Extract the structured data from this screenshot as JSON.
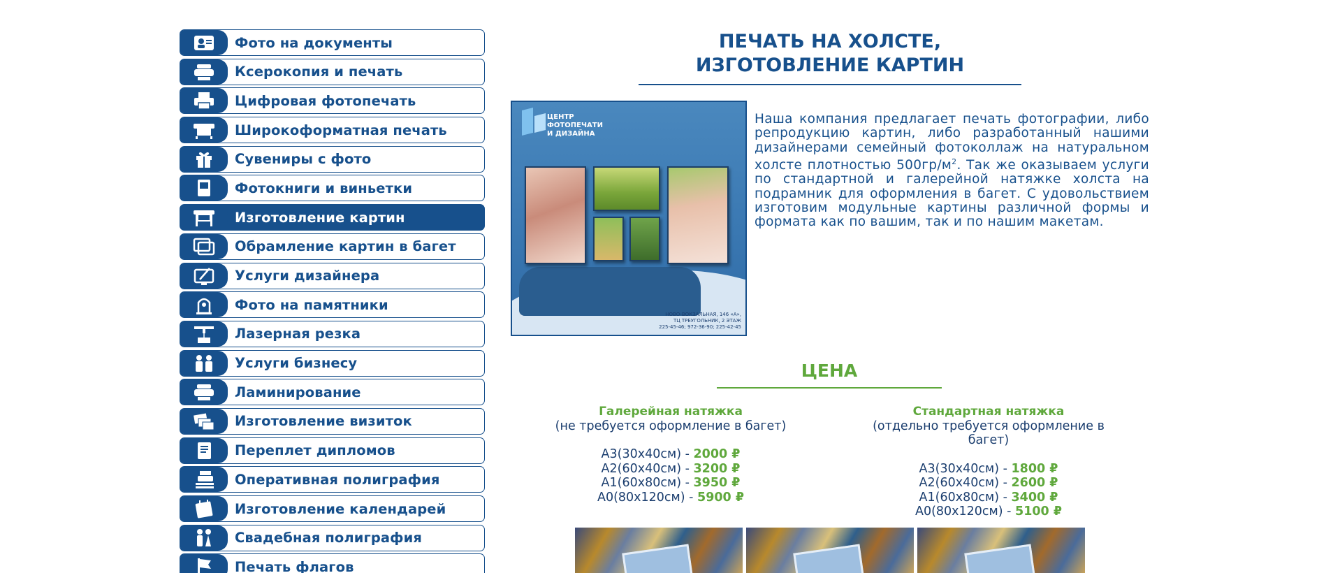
{
  "sidebar": {
    "items": [
      {
        "label": "Фото на документы",
        "icon": "id-photo-icon",
        "active": false
      },
      {
        "label": "Ксерокопия и печать",
        "icon": "copier-icon",
        "active": false
      },
      {
        "label": "Цифровая фотопечать",
        "icon": "printer-icon",
        "active": false
      },
      {
        "label": "Широкоформатная печать",
        "icon": "wide-printer-icon",
        "active": false
      },
      {
        "label": "Сувениры с фото",
        "icon": "gift-icon",
        "active": false
      },
      {
        "label": "Фотокниги и виньетки",
        "icon": "photobook-icon",
        "active": false
      },
      {
        "label": "Изготовление картин",
        "icon": "plotter-icon",
        "active": true
      },
      {
        "label": "Обрамление картин в багет",
        "icon": "frames-icon",
        "active": false
      },
      {
        "label": "Услуги дизайнера",
        "icon": "design-tablet-icon",
        "active": false
      },
      {
        "label": "Фото на памятники",
        "icon": "monument-icon",
        "active": false
      },
      {
        "label": "Лазерная резка",
        "icon": "laser-cutter-icon",
        "active": false
      },
      {
        "label": "Услуги бизнесу",
        "icon": "business-people-icon",
        "active": false
      },
      {
        "label": "Ламинирование",
        "icon": "laminator-icon",
        "active": false
      },
      {
        "label": "Изготовление визиток",
        "icon": "business-cards-icon",
        "active": false
      },
      {
        "label": "Переплет дипломов",
        "icon": "diploma-binding-icon",
        "active": false
      },
      {
        "label": "Оперативная полиграфия",
        "icon": "print-stack-icon",
        "active": false
      },
      {
        "label": "Изготовление календарей",
        "icon": "calendar-icon",
        "active": false
      },
      {
        "label": "Свадебная полиграфия",
        "icon": "wedding-couple-icon",
        "active": false
      },
      {
        "label": "Печать флагов",
        "icon": "flag-icon",
        "active": false
      }
    ]
  },
  "main": {
    "title_line1": "ПЕЧАТЬ НА ХОЛСТЕ,",
    "title_line2": "ИЗГОТОВЛЕНИЕ КАРТИН",
    "poster": {
      "brand_line1": "ЦЕНТР ФОТОПЕЧАТИ",
      "brand_line2": "И ДИЗАЙНА",
      "address_line1": "НОВО-ВОКЗАЛЬНАЯ, 146 «А»,",
      "address_line2": "ТЦ ТРЕУГОЛЬНИК, 2 ЭТАЖ",
      "address_line3": "225-45-46; 972-36-90; 225-42-45"
    },
    "description_part1": "Наша компания предлагает печать фотографии, либо репродукцию картин, либо разработанный нашими дизайнерами семейный фотоколлаж на натуральном холсте плотностью 500гр/м",
    "description_sup": "2",
    "description_part2": ". Так же оказываем услуги по стандартной и галерейной натяжке холста на подрамник для оформления в багет. С удовольствием изготовим модульные картины различной формы и формата как по вашим, так и по нашим макетам.",
    "price_title": "ЦЕНА",
    "gallery": {
      "heading": "Галерейная натяжка",
      "note": "(не требуется оформление в багет)",
      "rows": [
        {
          "size": "А3(30х40см) - ",
          "price": "2000 ₽"
        },
        {
          "size": "А2(60х40см) - ",
          "price": "3200 ₽"
        },
        {
          "size": "А1(60х80см) - ",
          "price": "3950 ₽"
        },
        {
          "size": "А0(80х120см) - ",
          "price": "5900 ₽"
        }
      ]
    },
    "standard": {
      "heading": "Стандартная натяжка",
      "note": "(отдельно требуется оформление в багет)",
      "rows": [
        {
          "size": "А3(30х40см) - ",
          "price": "1800 ₽"
        },
        {
          "size": "А2(60х40см) - ",
          "price": "2600 ₽"
        },
        {
          "size": "А1(60х80см) - ",
          "price": "3400 ₽"
        },
        {
          "size": "А0(80х120см) - ",
          "price": "5100 ₽"
        }
      ]
    }
  },
  "colors": {
    "brand_blue": "#17508c",
    "accent_green": "#5fa83c"
  }
}
